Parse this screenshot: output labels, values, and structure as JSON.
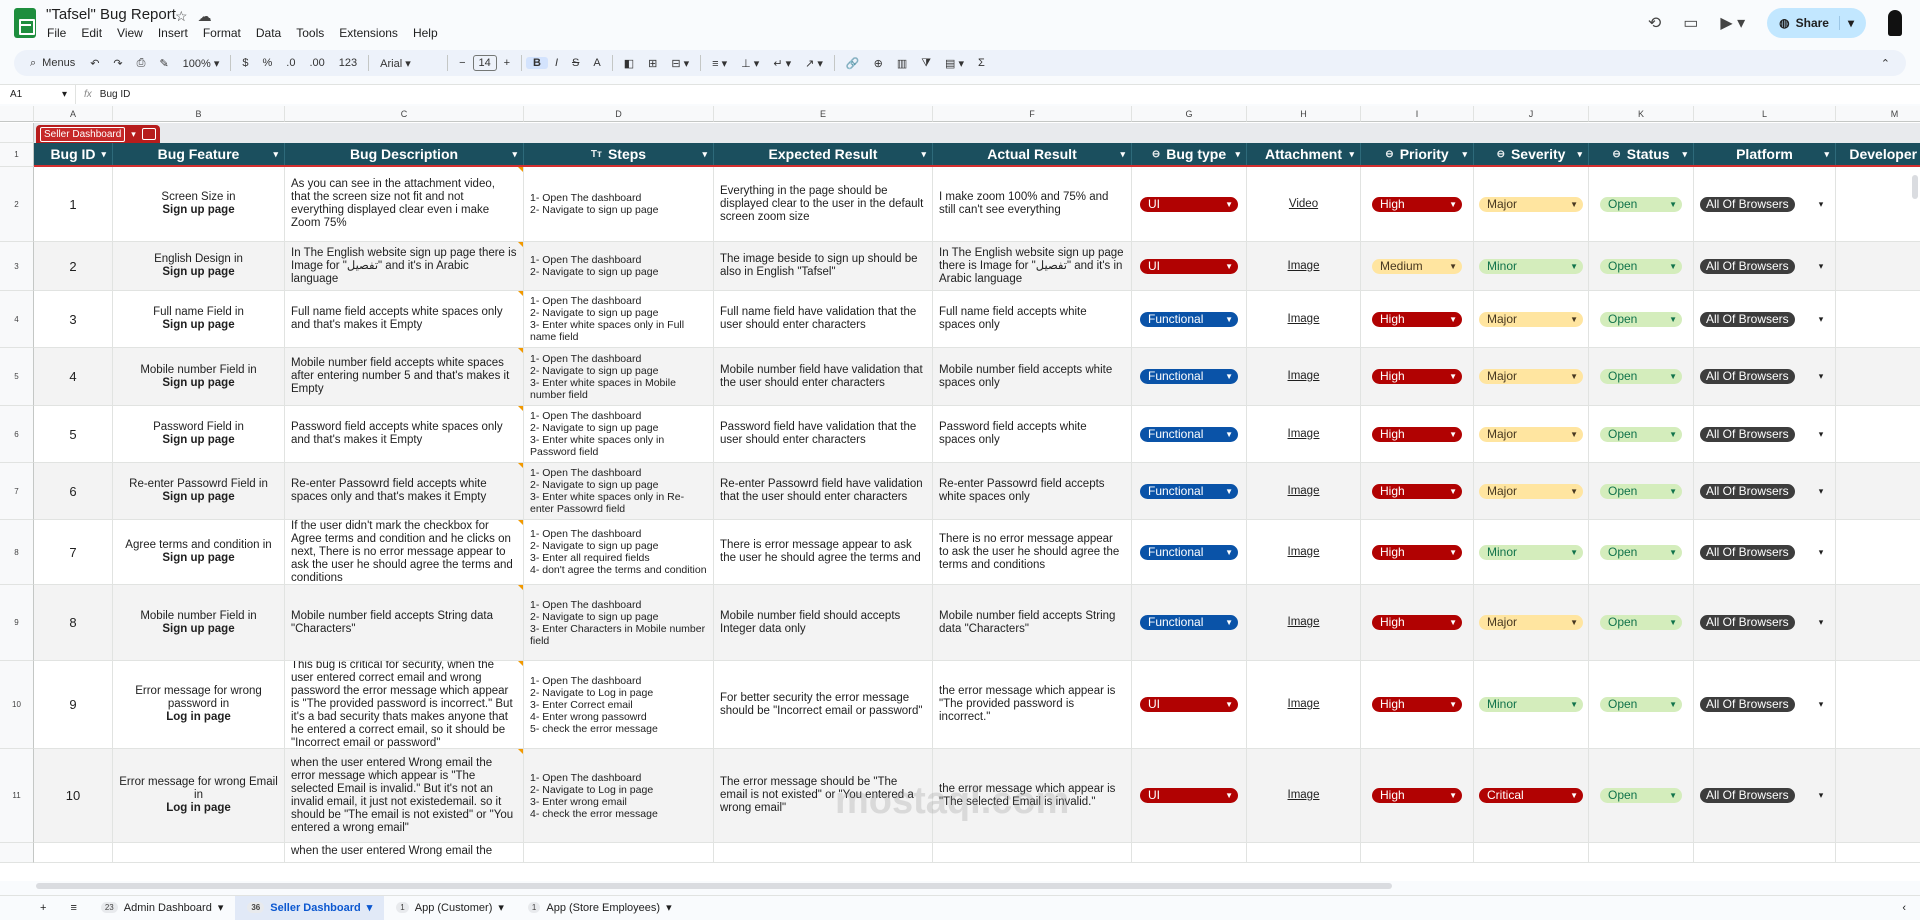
{
  "window": {
    "doc_title": "\"Tafsel\" Bug Report",
    "menus": [
      "File",
      "Edit",
      "View",
      "Insert",
      "Format",
      "Data",
      "Tools",
      "Extensions",
      "Help"
    ],
    "share_label": "Share"
  },
  "toolbar": {
    "menus_label": "Menus",
    "zoom": "100%",
    "currency": "$",
    "percent": "%",
    "dec_less": ".0",
    "dec_more": ".00",
    "number_fmt": "123",
    "font": "Arial",
    "font_size": "14",
    "minus": "−",
    "plus": "+",
    "bold": "B",
    "italic": "I",
    "strike": "S",
    "textcolor": "A",
    "sigma": "Σ"
  },
  "formula_bar": {
    "cell_ref": "A1",
    "fx": "fx",
    "content": "Bug ID"
  },
  "columns": [
    "A",
    "B",
    "C",
    "D",
    "E",
    "F",
    "G",
    "H",
    "I",
    "J",
    "K",
    "L",
    "M"
  ],
  "group_tab": "Seller Dashboard",
  "headers": [
    "Bug ID",
    "Bug Feature",
    "Bug Description",
    "Steps",
    "Expected Result",
    "Actual Result",
    "Bug type",
    "Attachment",
    "Priority",
    "Severity",
    "Status",
    "Platform",
    "Developer Co"
  ],
  "rows": [
    {
      "n": "2",
      "id": "1",
      "feature_top": "Screen Size in",
      "feature_bold": "Sign up page",
      "desc": "As you can see in the attachment video, that the screen size not fit and not everything displayed clear even i make Zoom 75%",
      "steps": "1- Open The dashboard\n2- Navigate to sign up page",
      "expected": "Everything in the page should be displayed clear to the user in the default screen zoom size",
      "actual": "I make zoom 100% and 75% and still can't see everything",
      "type": "UI",
      "attachment": "Video",
      "priority": "High",
      "severity": "Major",
      "status": "Open",
      "platform": "All Of Browsers"
    },
    {
      "n": "3",
      "id": "2",
      "feature_top": "English Design in",
      "feature_bold": "Sign up page",
      "desc": "In The English website sign up page there is Image for \"تفصيل\" and it's in Arabic language",
      "steps": "1- Open The dashboard\n2- Navigate to sign up page",
      "expected": "The image beside to sign up should be also in English \"Tafsel\"",
      "actual": "In The English website sign up page there is Image for \"تفصيل\" and it's in Arabic language",
      "type": "UI",
      "attachment": "Image",
      "priority": "Medium",
      "severity": "Minor",
      "status": "Open",
      "platform": "All Of Browsers"
    },
    {
      "n": "4",
      "id": "3",
      "feature_top": "Full name Field in",
      "feature_bold": "Sign up page",
      "desc": "Full name field accepts white spaces only and that's makes it Empty",
      "steps": "1- Open The dashboard\n2- Navigate to sign up page\n3- Enter white spaces only in Full name field",
      "expected": "Full name field have validation that the user should enter characters",
      "actual": "Full name field accepts white spaces only",
      "type": "Functional",
      "attachment": "Image",
      "priority": "High",
      "severity": "Major",
      "status": "Open",
      "platform": "All Of Browsers"
    },
    {
      "n": "5",
      "id": "4",
      "feature_top": "Mobile number Field in",
      "feature_bold": "Sign up page",
      "desc": "Mobile number field accepts white spaces after entering number 5 and that's makes it Empty",
      "steps": "1- Open The dashboard\n2- Navigate to sign up page\n3- Enter white spaces in Mobile number field",
      "expected": "Mobile number field have validation that the user should enter characters",
      "actual": "Mobile number field accepts white spaces only",
      "type": "Functional",
      "attachment": "Image",
      "priority": "High",
      "severity": "Major",
      "status": "Open",
      "platform": "All Of Browsers"
    },
    {
      "n": "6",
      "id": "5",
      "feature_top": "Password Field in",
      "feature_bold": "Sign up page",
      "desc": "Password field accepts white spaces only and that's makes it Empty",
      "steps": "1- Open The dashboard\n2- Navigate to sign up page\n3- Enter white spaces only in Password  field",
      "expected": "Password field have validation that the user should enter characters",
      "actual": "Password field accepts white spaces only",
      "type": "Functional",
      "attachment": "Image",
      "priority": "High",
      "severity": "Major",
      "status": "Open",
      "platform": "All Of Browsers"
    },
    {
      "n": "7",
      "id": "6",
      "feature_top": "Re-enter Passowrd Field in",
      "feature_bold": "Sign up page",
      "desc": "Re-enter Passowrd field accepts white spaces only and that's makes it Empty",
      "steps": "1- Open The dashboard\n2- Navigate to sign up page\n3- Enter white spaces only in Re-enter Passowrd field",
      "expected": "Re-enter Passowrd field have validation that the user should enter characters",
      "actual": "Re-enter Passowrd field accepts white spaces only",
      "type": "Functional",
      "attachment": "Image",
      "priority": "High",
      "severity": "Major",
      "status": "Open",
      "platform": "All Of Browsers"
    },
    {
      "n": "8",
      "id": "7",
      "feature_top": "Agree terms and condition in",
      "feature_bold": "Sign up page",
      "desc": "If the user didn't mark the checkbox for Agree terms and condition and he clicks on next, There is no error message appear to ask the user he should agree the terms and conditions",
      "steps": "1- Open The dashboard\n2- Navigate to sign up page\n3- Enter all required fields\n4- don't agree the terms and condition",
      "expected": "There is error message appear to ask the user he should agree the terms and",
      "actual": "There is no error message appear to ask the user he should agree the terms and conditions",
      "type": "Functional",
      "attachment": "Image",
      "priority": "High",
      "severity": "Minor",
      "status": "Open",
      "platform": "All Of Browsers"
    },
    {
      "n": "9",
      "id": "8",
      "feature_top": "Mobile number Field in",
      "feature_bold": "Sign up page",
      "desc": "Mobile number field accepts String data \"Characters\"",
      "steps": "1- Open The dashboard\n2- Navigate to sign up page\n3- Enter Characters in Mobile number field",
      "expected": "Mobile number field should accepts Integer data only",
      "actual": "Mobile number field accepts String data \"Characters\"",
      "type": "Functional",
      "attachment": "Image",
      "priority": "High",
      "severity": "Major",
      "status": "Open",
      "platform": "All Of Browsers"
    },
    {
      "n": "10",
      "id": "9",
      "feature_top": "Error message for wrong password in",
      "feature_bold": "Log in page",
      "desc": "This bug is critical for security, when the user entered correct email and wrong password the error message which appear is \"The provided password is incorrect.\" But it's a bad security thats makes anyone that he entered a correct email, so it should be \"Incorrect email or password\"",
      "steps": "1- Open The dashboard\n2- Navigate to Log in page\n3- Enter Correct email\n4- Enter wrong passowrd\n5- check the error message",
      "expected": "For better security the error message should be \"Incorrect email or password\"",
      "actual": "the error message which appear is \"The provided password is incorrect.\"",
      "type": "UI",
      "attachment": "Image",
      "priority": "High",
      "severity": "Minor",
      "status": "Open",
      "platform": "All Of Browsers"
    },
    {
      "n": "11",
      "id": "10",
      "feature_top": "Error message for wrong Email in",
      "feature_bold": "Log in page",
      "desc": "when the user entered Wrong email the error message which appear is \"The selected Email is invalid.\" But it's not an invalid email, it just not existedemail. so it should be \"The email is not existed\" or \"You entered a wrong email\"",
      "steps": "1- Open The dashboard\n2- Navigate to Log in page\n3- Enter wrong email\n4- check the error message",
      "expected": "The error message should be \"The email is not existed\" or \"You entered a wrong email\"",
      "actual": "the error message which appear is \"The selected Email is invalid.\"",
      "type": "UI",
      "attachment": "Image",
      "priority": "High",
      "severity": "Critical",
      "status": "Open",
      "platform": "All Of Browsers"
    }
  ],
  "partial_row_text": "when the user entered Wrong email the",
  "sheets": [
    {
      "badge": "23",
      "name": "Admin Dashboard"
    },
    {
      "badge": "36",
      "name": "Seller Dashboard"
    },
    {
      "badge": "1",
      "name": "App (Customer)"
    },
    {
      "badge": "1",
      "name": "App (Store Employees)"
    }
  ],
  "watermark": "mostaql.com",
  "colors": {
    "header_bg": "#1b4f5e",
    "group_tab": "#b71c1c",
    "high": "#b10202",
    "functional": "#0a53a8",
    "major": "#ffe5a0",
    "minor": "#d4edbc"
  }
}
